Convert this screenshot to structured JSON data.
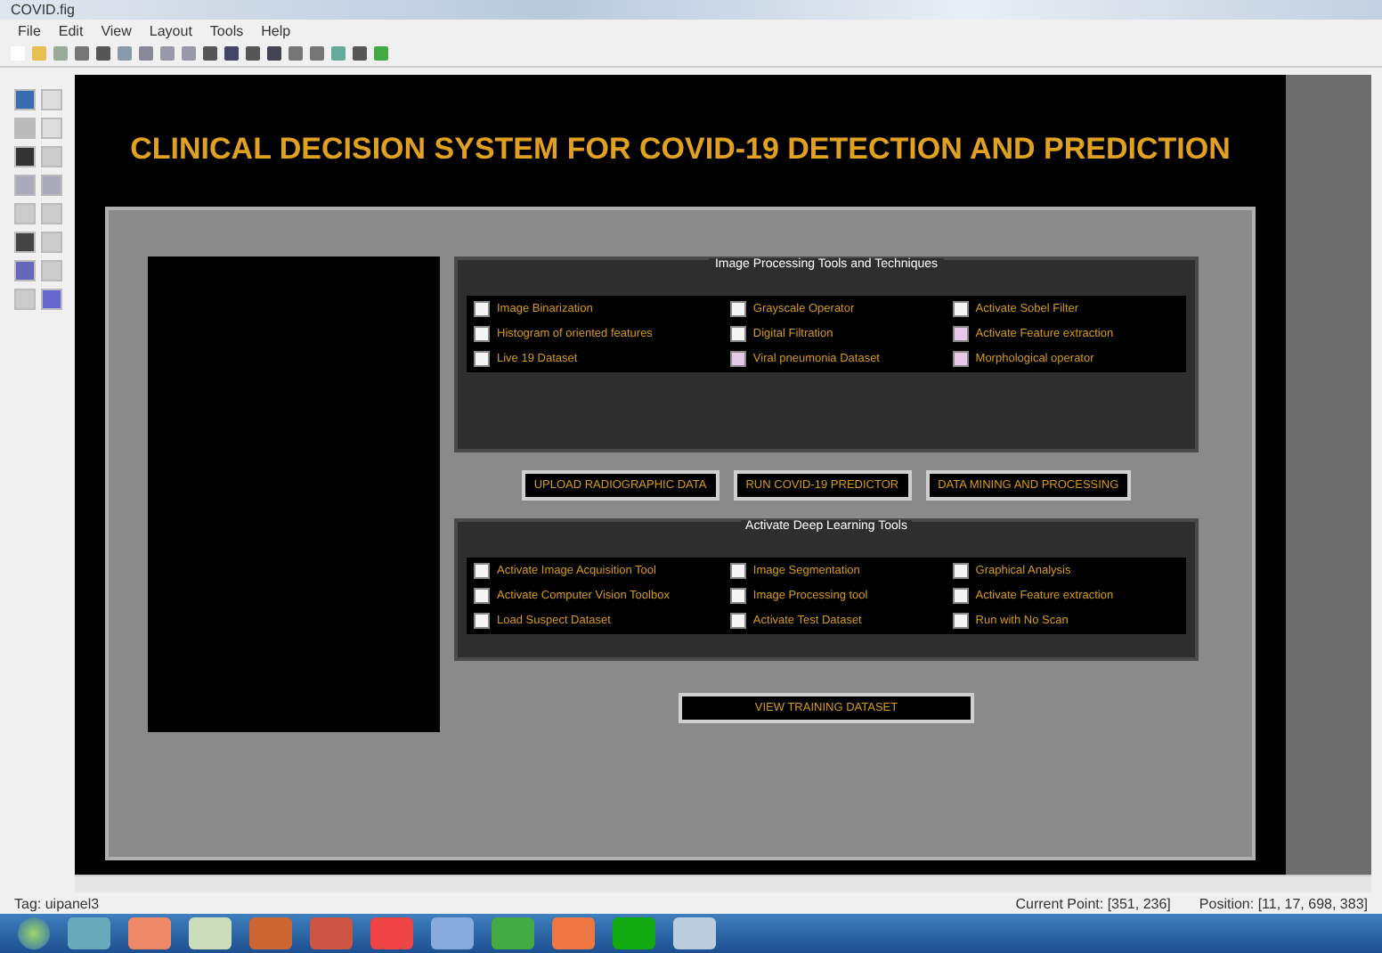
{
  "window": {
    "title": "COVID.fig"
  },
  "menu": [
    "File",
    "Edit",
    "View",
    "Layout",
    "Tools",
    "Help"
  ],
  "figure": {
    "heading": "CLINICAL DECISION SYSTEM FOR COVID-19 DETECTION AND PREDICTION"
  },
  "panels": [
    {
      "title": "Image Processing Tools and Techniques",
      "columns": [
        [
          {
            "label": "Image Binarization",
            "checked": false
          },
          {
            "label": "Histogram of oriented features",
            "checked": false
          },
          {
            "label": "Live 19 Dataset",
            "checked": false
          }
        ],
        [
          {
            "label": "Grayscale Operator",
            "checked": false
          },
          {
            "label": "Digital Filtration",
            "checked": false
          },
          {
            "label": "Viral pneumonia Dataset",
            "checked": true
          }
        ],
        [
          {
            "label": "Activate Sobel Filter",
            "checked": false
          },
          {
            "label": "Activate Feature extraction",
            "checked": true
          },
          {
            "label": "Morphological operator",
            "checked": true
          }
        ]
      ]
    },
    {
      "title": "Activate Deep Learning Tools",
      "columns": [
        [
          {
            "label": "Activate Image Acquisition Tool",
            "checked": false
          },
          {
            "label": "Activate Computer Vision Toolbox",
            "checked": false
          },
          {
            "label": "Load Suspect Dataset",
            "checked": false
          }
        ],
        [
          {
            "label": "Image Segmentation",
            "checked": false
          },
          {
            "label": "Image Processing tool",
            "checked": false
          },
          {
            "label": "Activate Test Dataset",
            "checked": false
          }
        ],
        [
          {
            "label": "Graphical Analysis",
            "checked": false
          },
          {
            "label": "Activate Feature extraction",
            "checked": false
          },
          {
            "label": "Run with No Scan",
            "checked": false
          }
        ]
      ]
    }
  ],
  "buttons": [
    "UPLOAD RADIOGRAPHIC DATA",
    "RUN COVID-19 PREDICTOR",
    "DATA MINING AND PROCESSING"
  ],
  "view_button": "VIEW TRAINING DATASET",
  "status_bar": {
    "tag": "Tag: uipanel3",
    "current_point": "Current Point: [351, 236]",
    "position": "Position: [11, 17, 698, 383]"
  }
}
